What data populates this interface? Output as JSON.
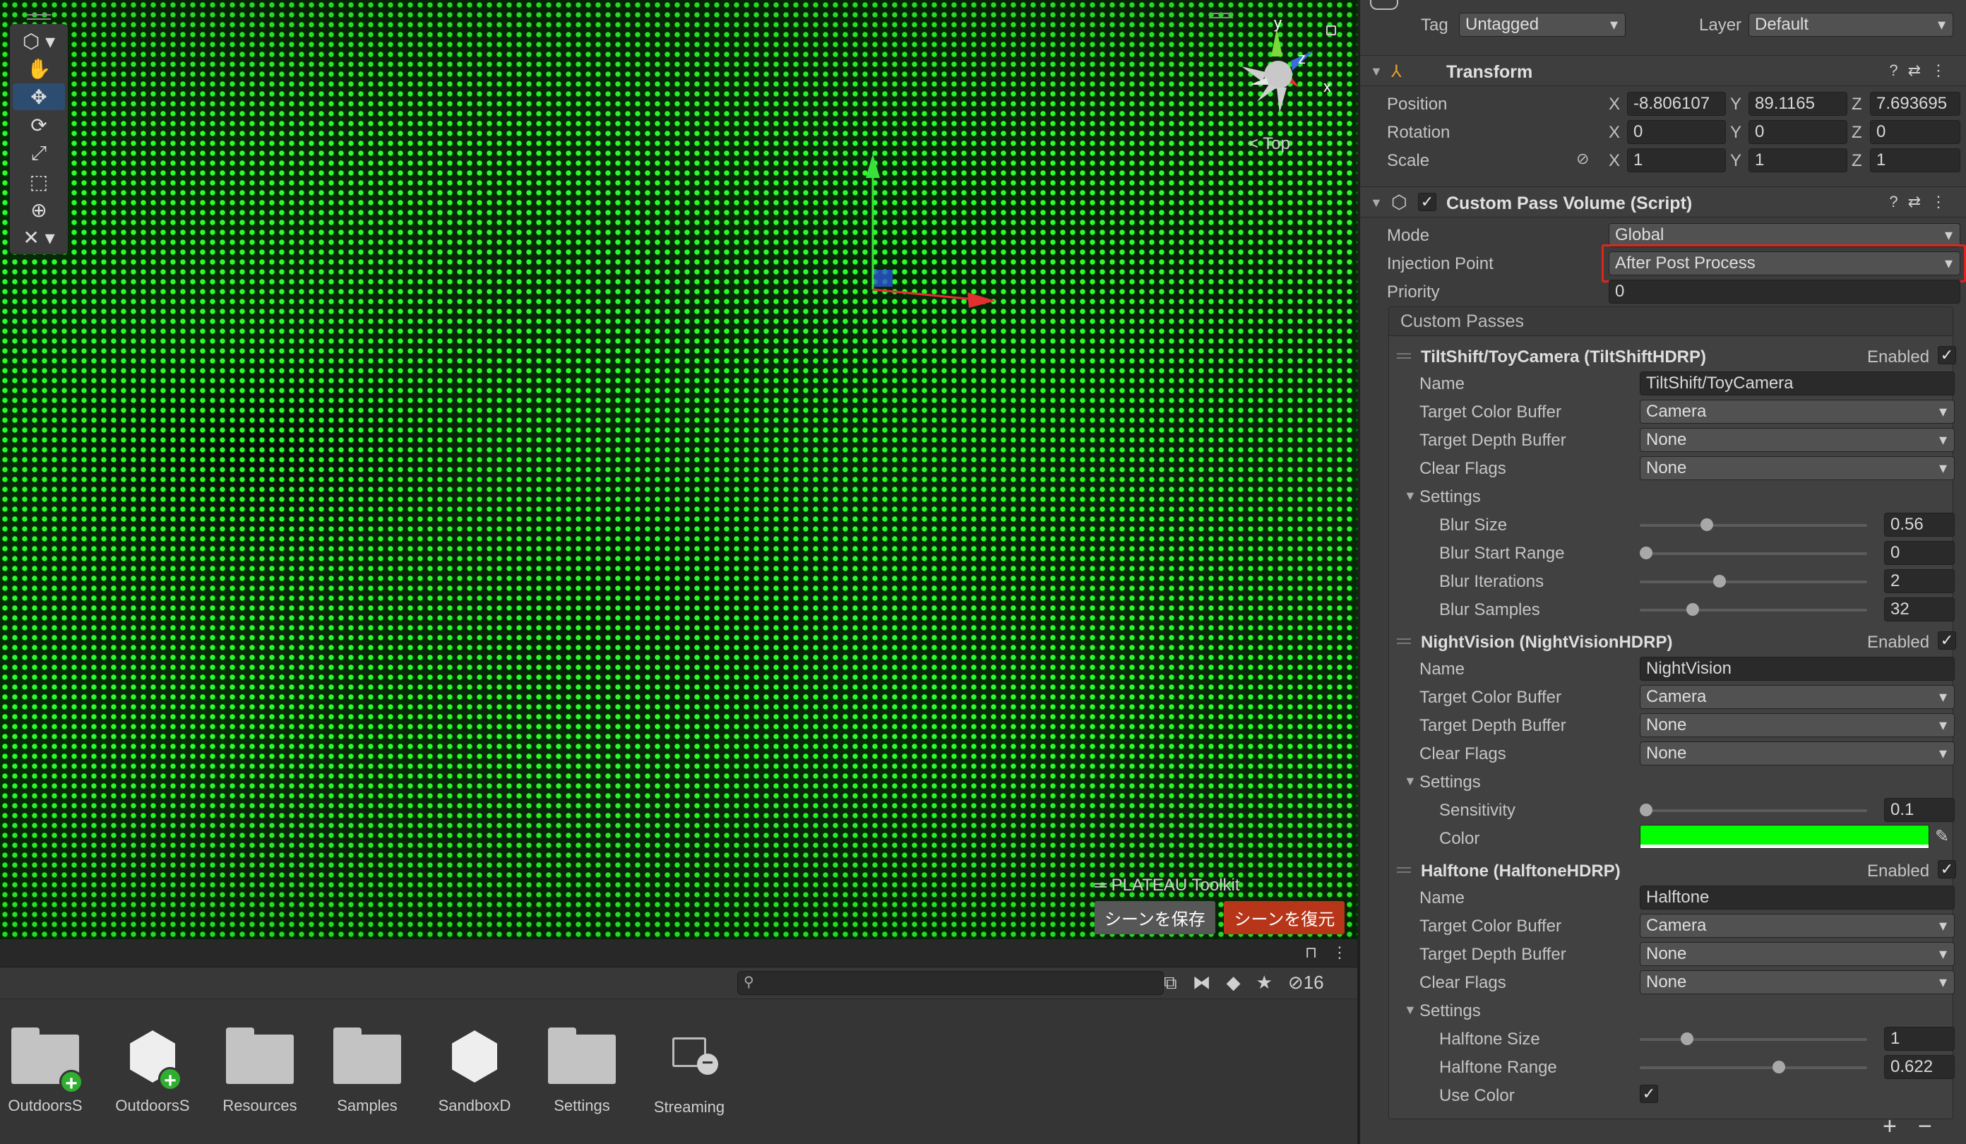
{
  "scene": {
    "gizmo": {
      "y": "y",
      "z": "z",
      "x": "x"
    },
    "view_label": "Top",
    "plateau": {
      "title": "PLATEAU Toolkit",
      "save": "シーンを保存",
      "restore": "シーンを復元"
    }
  },
  "project": {
    "hidden_count": "16",
    "assets": [
      {
        "label": "OutdoorsS",
        "icon": "folder-icon",
        "badge": "add"
      },
      {
        "label": "OutdoorsS",
        "icon": "unity-scene-icon",
        "badge": "add"
      },
      {
        "label": "Resources",
        "icon": "folder-icon"
      },
      {
        "label": "Samples",
        "icon": "folder-icon"
      },
      {
        "label": "SandboxD",
        "icon": "unity-scene-icon"
      },
      {
        "label": "Settings",
        "icon": "folder-icon"
      },
      {
        "label": "Streaming",
        "icon": "folder-outline-icon",
        "badge": "remove"
      }
    ]
  },
  "inspector": {
    "tag_label": "Tag",
    "tag_value": "Untagged",
    "layer_label": "Layer",
    "layer_value": "Default",
    "transform": {
      "title": "Transform",
      "position_label": "Position",
      "rotation_label": "Rotation",
      "scale_label": "Scale",
      "axis_x": "X",
      "axis_y": "Y",
      "axis_z": "Z",
      "position": {
        "x": "-8.806107",
        "y": "89.1165",
        "z": "7.693695"
      },
      "rotation": {
        "x": "0",
        "y": "0",
        "z": "0"
      },
      "scale": {
        "x": "1",
        "y": "1",
        "z": "1"
      }
    },
    "cpv": {
      "title": "Custom Pass Volume (Script)",
      "mode_label": "Mode",
      "mode_value": "Global",
      "injection_label": "Injection Point",
      "injection_value": "After Post Process",
      "priority_label": "Priority",
      "priority_value": "0",
      "custom_passes_label": "Custom Passes",
      "enabled_label": "Enabled",
      "name_label": "Name",
      "tcb_label": "Target Color Buffer",
      "tdb_label": "Target Depth Buffer",
      "cf_label": "Clear Flags",
      "settings_label": "Settings",
      "passes": [
        {
          "title": "TiltShift/ToyCamera (TiltShiftHDRP)",
          "name": "TiltShift/ToyCamera",
          "tcb": "Camera",
          "tdb": "None",
          "cf": "None",
          "settings": [
            {
              "label": "Blur Size",
              "value": "0.56"
            },
            {
              "label": "Blur Start Range",
              "value": "0"
            },
            {
              "label": "Blur Iterations",
              "value": "2"
            },
            {
              "label": "Blur Samples",
              "value": "32"
            }
          ]
        },
        {
          "title": "NightVision (NightVisionHDRP)",
          "name": "NightVision",
          "tcb": "Camera",
          "tdb": "None",
          "cf": "None",
          "settings": [
            {
              "label": "Sensitivity",
              "value": "0.1"
            },
            {
              "label": "Color",
              "color": "#00ff00"
            }
          ]
        },
        {
          "title": "Halftone (HalftoneHDRP)",
          "name": "Halftone",
          "tcb": "Camera",
          "tdb": "None",
          "cf": "None",
          "settings": [
            {
              "label": "Halftone Size",
              "value": "1"
            },
            {
              "label": "Halftone Range",
              "value": "0.622"
            },
            {
              "label": "Use Color",
              "checked": true
            }
          ]
        }
      ]
    }
  },
  "colors": {
    "accent": "#2d4d70",
    "highlight": "#e0261b",
    "nightvision": "#00ff00"
  }
}
